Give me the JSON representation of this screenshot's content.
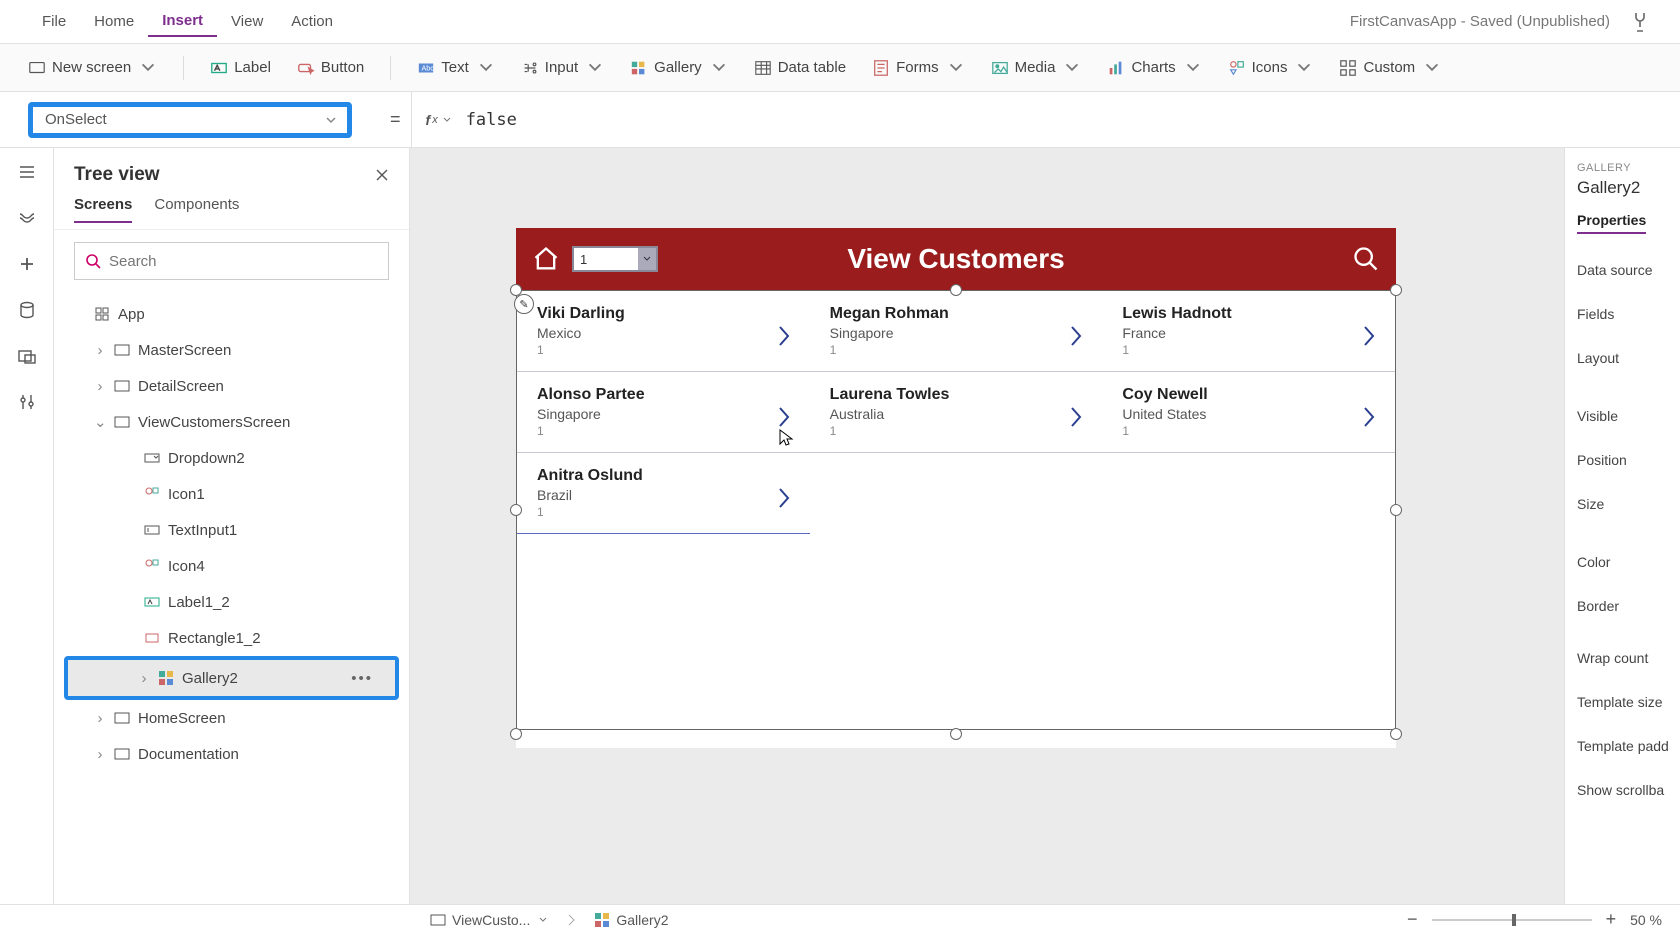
{
  "menubar": {
    "items": [
      "File",
      "Home",
      "Insert",
      "View",
      "Action"
    ],
    "activeIndex": 2,
    "appTitle": "FirstCanvasApp - Saved (Unpublished)"
  },
  "ribbon": {
    "newScreen": "New screen",
    "label": "Label",
    "button": "Button",
    "text": "Text",
    "input": "Input",
    "gallery": "Gallery",
    "dataTable": "Data table",
    "forms": "Forms",
    "media": "Media",
    "charts": "Charts",
    "icons": "Icons",
    "custom": "Custom"
  },
  "formula": {
    "property": "OnSelect",
    "value": "false"
  },
  "tree": {
    "title": "Tree view",
    "tabs": [
      "Screens",
      "Components"
    ],
    "activeTab": 0,
    "searchPlaceholder": "Search",
    "nodes": {
      "app": "App",
      "master": "MasterScreen",
      "detail": "DetailScreen",
      "viewCust": "ViewCustomersScreen",
      "dropdown2": "Dropdown2",
      "icon1": "Icon1",
      "textInput1": "TextInput1",
      "icon4": "Icon4",
      "label1_2": "Label1_2",
      "rectangle1_2": "Rectangle1_2",
      "gallery2": "Gallery2",
      "home": "HomeScreen",
      "docs": "Documentation"
    }
  },
  "canvas": {
    "headerTitle": "View Customers",
    "dropdownValue": "1",
    "customers": [
      {
        "name": "Viki  Darling",
        "loc": "Mexico",
        "num": "1"
      },
      {
        "name": "Megan  Rohman",
        "loc": "Singapore",
        "num": "1"
      },
      {
        "name": "Lewis  Hadnott",
        "loc": "France",
        "num": "1"
      },
      {
        "name": "Alonso  Partee",
        "loc": "Singapore",
        "num": "1"
      },
      {
        "name": "Laurena  Towles",
        "loc": "Australia",
        "num": "1"
      },
      {
        "name": "Coy  Newell",
        "loc": "United States",
        "num": "1"
      },
      {
        "name": "Anitra  Oslund",
        "loc": "Brazil",
        "num": "1"
      }
    ]
  },
  "props": {
    "category": "GALLERY",
    "name": "Gallery2",
    "tab": "Properties",
    "rows": [
      "Data source",
      "Fields",
      "Layout",
      "Visible",
      "Position",
      "Size",
      "Color",
      "Border",
      "Wrap count",
      "Template size",
      "Template padd",
      "Show scrollba"
    ]
  },
  "breadcrumb": {
    "screen": "ViewCusto...",
    "control": "Gallery2"
  },
  "zoom": {
    "pctLabel": "50  %"
  }
}
